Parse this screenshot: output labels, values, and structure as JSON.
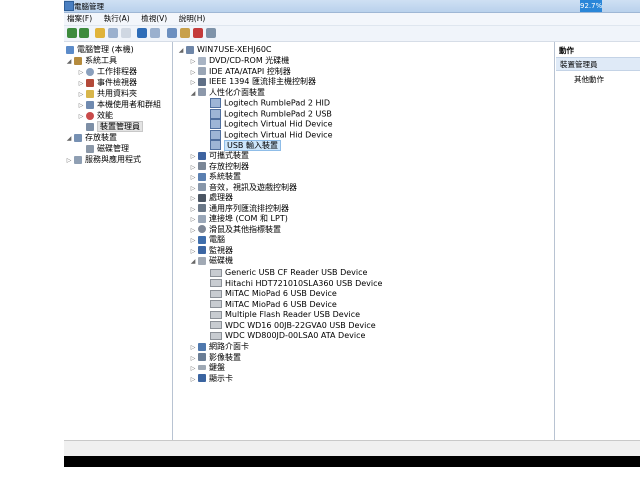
{
  "window": {
    "title": "電腦管理",
    "cpu_badge": "92.7%"
  },
  "menu": {
    "items": [
      "檔案(F)",
      "執行(A)",
      "檢視(V)",
      "說明(H)"
    ]
  },
  "toolbar": {
    "buttons": [
      "back-icon",
      "forward-icon",
      "up-icon",
      "show-hide-tree-icon",
      "properties-icon",
      "help-icon",
      "action-pane-icon",
      "update-driver-icon",
      "disable-icon",
      "uninstall-icon",
      "scan-hardware-icon"
    ]
  },
  "left_tree": {
    "root": "電腦管理 (本機)",
    "system_tools": "系統工具",
    "items": [
      "工作排程器",
      "事件檢視器",
      "共用資料夾",
      "本機使用者和群組",
      "效能",
      "裝置管理員"
    ],
    "storage": "存放裝置",
    "disk_mgmt": "磁碟管理",
    "services": "服務與應用程式"
  },
  "device_tree": {
    "computer": "WIN7USE-XEHJ60C",
    "categories": [
      "DVD/CD-ROM 光碟機",
      "IDE ATA/ATAPI 控制器",
      "IEEE 1394 匯流排主機控制器",
      "人性化介面裝置"
    ],
    "hid_children": [
      "Logitech RumblePad 2 HID",
      "Logitech RumblePad 2 USB",
      "Logitech Virtual Hid Device",
      "Logitech Virtual Hid Device",
      "USB 輸入裝置"
    ],
    "categories_after_hid": [
      "可攜式裝置",
      "存放控制器",
      "系統裝置",
      "音效，視訊及遊戲控制器",
      "處理器",
      "通用序列匯流排控制器",
      "連接埠 (COM 和 LPT)",
      "滑鼠及其他指標裝置",
      "電腦",
      "監視器",
      "磁碟機"
    ],
    "disk_children": [
      "Generic USB CF Reader USB Device",
      "Hitachi HDT721010SLA360 USB Device",
      "MiTAC MioPad 6 USB Device",
      "MiTAC MioPad 6 USB Device",
      "Multiple Flash Reader USB Device",
      "WDC WD16 00JB-22GVA0 USB Device",
      "WDC WD800JD-00LSA0 ATA Device"
    ],
    "categories_last": [
      "網路介面卡",
      "影像裝置",
      "鍵盤",
      "顯示卡"
    ]
  },
  "actions": {
    "header": "動作",
    "section": "裝置管理員",
    "item": "其他動作"
  }
}
